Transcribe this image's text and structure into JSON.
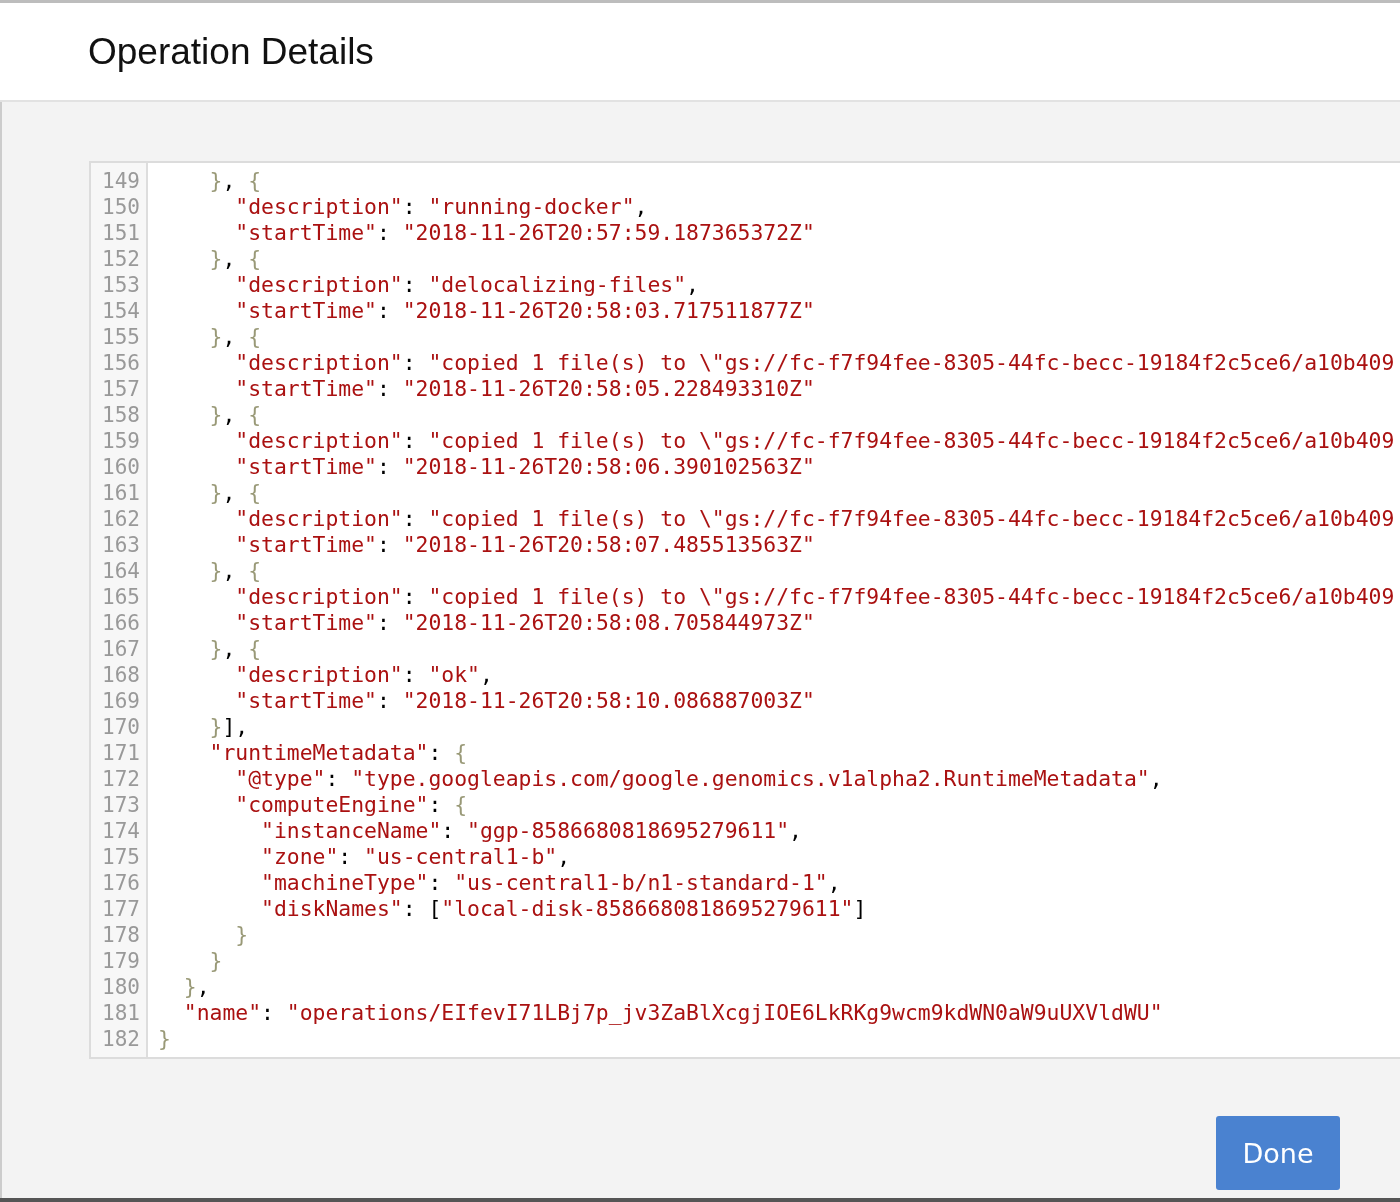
{
  "dialog": {
    "title": "Operation Details",
    "editor": {
      "lines": [
        {
          "number": "149",
          "tokens": [
            {
              "kind": "brc",
              "text": "    }"
            },
            {
              "kind": "pun",
              "text": ", "
            },
            {
              "kind": "brc",
              "text": "{"
            }
          ]
        },
        {
          "number": "150",
          "tokens": [
            {
              "kind": "str",
              "text": "      \"description\""
            },
            {
              "kind": "pun",
              "text": ": "
            },
            {
              "kind": "str",
              "text": "\"running-docker\""
            },
            {
              "kind": "pun",
              "text": ","
            }
          ]
        },
        {
          "number": "151",
          "tokens": [
            {
              "kind": "str",
              "text": "      \"startTime\""
            },
            {
              "kind": "pun",
              "text": ": "
            },
            {
              "kind": "str",
              "text": "\"2018-11-26T20:57:59.187365372Z\""
            }
          ]
        },
        {
          "number": "152",
          "tokens": [
            {
              "kind": "brc",
              "text": "    }"
            },
            {
              "kind": "pun",
              "text": ", "
            },
            {
              "kind": "brc",
              "text": "{"
            }
          ]
        },
        {
          "number": "153",
          "tokens": [
            {
              "kind": "str",
              "text": "      \"description\""
            },
            {
              "kind": "pun",
              "text": ": "
            },
            {
              "kind": "str",
              "text": "\"delocalizing-files\""
            },
            {
              "kind": "pun",
              "text": ","
            }
          ]
        },
        {
          "number": "154",
          "tokens": [
            {
              "kind": "str",
              "text": "      \"startTime\""
            },
            {
              "kind": "pun",
              "text": ": "
            },
            {
              "kind": "str",
              "text": "\"2018-11-26T20:58:03.717511877Z\""
            }
          ]
        },
        {
          "number": "155",
          "tokens": [
            {
              "kind": "brc",
              "text": "    }"
            },
            {
              "kind": "pun",
              "text": ", "
            },
            {
              "kind": "brc",
              "text": "{"
            }
          ]
        },
        {
          "number": "156",
          "tokens": [
            {
              "kind": "str",
              "text": "      \"description\""
            },
            {
              "kind": "pun",
              "text": ": "
            },
            {
              "kind": "str",
              "text": "\"copied 1 file(s) to \\\"gs://fc-f7f94fee-8305-44fc-becc-19184f2c5ce6/a10b409"
            }
          ]
        },
        {
          "number": "157",
          "tokens": [
            {
              "kind": "str",
              "text": "      \"startTime\""
            },
            {
              "kind": "pun",
              "text": ": "
            },
            {
              "kind": "str",
              "text": "\"2018-11-26T20:58:05.228493310Z\""
            }
          ]
        },
        {
          "number": "158",
          "tokens": [
            {
              "kind": "brc",
              "text": "    }"
            },
            {
              "kind": "pun",
              "text": ", "
            },
            {
              "kind": "brc",
              "text": "{"
            }
          ]
        },
        {
          "number": "159",
          "tokens": [
            {
              "kind": "str",
              "text": "      \"description\""
            },
            {
              "kind": "pun",
              "text": ": "
            },
            {
              "kind": "str",
              "text": "\"copied 1 file(s) to \\\"gs://fc-f7f94fee-8305-44fc-becc-19184f2c5ce6/a10b409"
            }
          ]
        },
        {
          "number": "160",
          "tokens": [
            {
              "kind": "str",
              "text": "      \"startTime\""
            },
            {
              "kind": "pun",
              "text": ": "
            },
            {
              "kind": "str",
              "text": "\"2018-11-26T20:58:06.390102563Z\""
            }
          ]
        },
        {
          "number": "161",
          "tokens": [
            {
              "kind": "brc",
              "text": "    }"
            },
            {
              "kind": "pun",
              "text": ", "
            },
            {
              "kind": "brc",
              "text": "{"
            }
          ]
        },
        {
          "number": "162",
          "tokens": [
            {
              "kind": "str",
              "text": "      \"description\""
            },
            {
              "kind": "pun",
              "text": ": "
            },
            {
              "kind": "str",
              "text": "\"copied 1 file(s) to \\\"gs://fc-f7f94fee-8305-44fc-becc-19184f2c5ce6/a10b409"
            }
          ]
        },
        {
          "number": "163",
          "tokens": [
            {
              "kind": "str",
              "text": "      \"startTime\""
            },
            {
              "kind": "pun",
              "text": ": "
            },
            {
              "kind": "str",
              "text": "\"2018-11-26T20:58:07.485513563Z\""
            }
          ]
        },
        {
          "number": "164",
          "tokens": [
            {
              "kind": "brc",
              "text": "    }"
            },
            {
              "kind": "pun",
              "text": ", "
            },
            {
              "kind": "brc",
              "text": "{"
            }
          ]
        },
        {
          "number": "165",
          "tokens": [
            {
              "kind": "str",
              "text": "      \"description\""
            },
            {
              "kind": "pun",
              "text": ": "
            },
            {
              "kind": "str",
              "text": "\"copied 1 file(s) to \\\"gs://fc-f7f94fee-8305-44fc-becc-19184f2c5ce6/a10b409"
            }
          ]
        },
        {
          "number": "166",
          "tokens": [
            {
              "kind": "str",
              "text": "      \"startTime\""
            },
            {
              "kind": "pun",
              "text": ": "
            },
            {
              "kind": "str",
              "text": "\"2018-11-26T20:58:08.705844973Z\""
            }
          ]
        },
        {
          "number": "167",
          "tokens": [
            {
              "kind": "brc",
              "text": "    }"
            },
            {
              "kind": "pun",
              "text": ", "
            },
            {
              "kind": "brc",
              "text": "{"
            }
          ]
        },
        {
          "number": "168",
          "tokens": [
            {
              "kind": "str",
              "text": "      \"description\""
            },
            {
              "kind": "pun",
              "text": ": "
            },
            {
              "kind": "str",
              "text": "\"ok\""
            },
            {
              "kind": "pun",
              "text": ","
            }
          ]
        },
        {
          "number": "169",
          "tokens": [
            {
              "kind": "str",
              "text": "      \"startTime\""
            },
            {
              "kind": "pun",
              "text": ": "
            },
            {
              "kind": "str",
              "text": "\"2018-11-26T20:58:10.086887003Z\""
            }
          ]
        },
        {
          "number": "170",
          "tokens": [
            {
              "kind": "brc",
              "text": "    }"
            },
            {
              "kind": "pun",
              "text": "],"
            }
          ]
        },
        {
          "number": "171",
          "tokens": [
            {
              "kind": "str",
              "text": "    \"runtimeMetadata\""
            },
            {
              "kind": "pun",
              "text": ": "
            },
            {
              "kind": "brc",
              "text": "{"
            }
          ]
        },
        {
          "number": "172",
          "tokens": [
            {
              "kind": "str",
              "text": "      \"@type\""
            },
            {
              "kind": "pun",
              "text": ": "
            },
            {
              "kind": "str",
              "text": "\"type.googleapis.com/google.genomics.v1alpha2.RuntimeMetadata\""
            },
            {
              "kind": "pun",
              "text": ","
            }
          ]
        },
        {
          "number": "173",
          "tokens": [
            {
              "kind": "str",
              "text": "      \"computeEngine\""
            },
            {
              "kind": "pun",
              "text": ": "
            },
            {
              "kind": "brc",
              "text": "{"
            }
          ]
        },
        {
          "number": "174",
          "tokens": [
            {
              "kind": "str",
              "text": "        \"instanceName\""
            },
            {
              "kind": "pun",
              "text": ": "
            },
            {
              "kind": "str",
              "text": "\"ggp-8586680818695279611\""
            },
            {
              "kind": "pun",
              "text": ","
            }
          ]
        },
        {
          "number": "175",
          "tokens": [
            {
              "kind": "str",
              "text": "        \"zone\""
            },
            {
              "kind": "pun",
              "text": ": "
            },
            {
              "kind": "str",
              "text": "\"us-central1-b\""
            },
            {
              "kind": "pun",
              "text": ","
            }
          ]
        },
        {
          "number": "176",
          "tokens": [
            {
              "kind": "str",
              "text": "        \"machineType\""
            },
            {
              "kind": "pun",
              "text": ": "
            },
            {
              "kind": "str",
              "text": "\"us-central1-b/n1-standard-1\""
            },
            {
              "kind": "pun",
              "text": ","
            }
          ]
        },
        {
          "number": "177",
          "tokens": [
            {
              "kind": "str",
              "text": "        \"diskNames\""
            },
            {
              "kind": "pun",
              "text": ": ["
            },
            {
              "kind": "str",
              "text": "\"local-disk-8586680818695279611\""
            },
            {
              "kind": "pun",
              "text": "]"
            }
          ]
        },
        {
          "number": "178",
          "tokens": [
            {
              "kind": "brc",
              "text": "      }"
            }
          ]
        },
        {
          "number": "179",
          "tokens": [
            {
              "kind": "brc",
              "text": "    }"
            }
          ]
        },
        {
          "number": "180",
          "tokens": [
            {
              "kind": "brc",
              "text": "  }"
            },
            {
              "kind": "pun",
              "text": ","
            }
          ]
        },
        {
          "number": "181",
          "tokens": [
            {
              "kind": "str",
              "text": "  \"name\""
            },
            {
              "kind": "pun",
              "text": ": "
            },
            {
              "kind": "str",
              "text": "\"operations/EIfevI71LBj7p_jv3ZaBlXcgjIOE6LkRKg9wcm9kdWN0aW9uUXVldWU\""
            }
          ]
        },
        {
          "number": "182",
          "tokens": [
            {
              "kind": "brc",
              "text": "}"
            }
          ]
        }
      ]
    },
    "buttons": [
      {
        "label": "Done"
      }
    ]
  }
}
